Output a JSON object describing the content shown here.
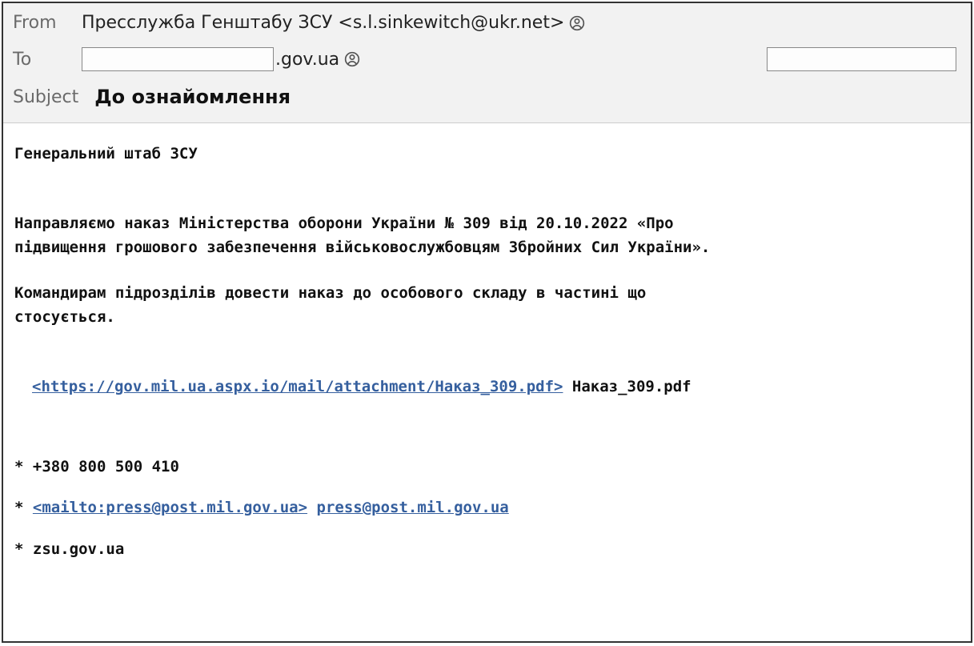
{
  "header": {
    "from_label": "From",
    "from_value": "Пресслужба Генштабу ЗСУ <s.l.sinkewitch@ukr.net>",
    "to_label": "To",
    "to_redacted_suffix": ".gov.ua",
    "subject_label": "Subject",
    "subject_value": "До ознайомлення"
  },
  "body": {
    "greeting": "Генеральний штаб ЗСУ",
    "para1_line1": "Направляємо наказ Міністерства оборони України № 309 від 20.10.2022 «Про",
    "para1_line2": "підвищення грошового забезпечення військовослужбовцям Збройних Сил України».",
    "para2_line1": "Командирам підрозділів довести наказ до особового складу в частині що",
    "para2_line2": "стосується.",
    "attachment_link": "<https://gov.mil.ua.aspx.io/mail/attachment/Наказ_309.pdf>",
    "attachment_name": " Наказ_309.pdf",
    "footer_phone_prefix": "* ",
    "footer_phone": "+380 800 500 410",
    "footer_mail_prefix": "*  ",
    "footer_mailto_link": "<mailto:press@post.mil.gov.ua>",
    "footer_mail_sep": " ",
    "footer_mail_text": "press@post.mil.gov.ua",
    "footer_site_prefix": "* ",
    "footer_site": "zsu.gov.ua"
  }
}
